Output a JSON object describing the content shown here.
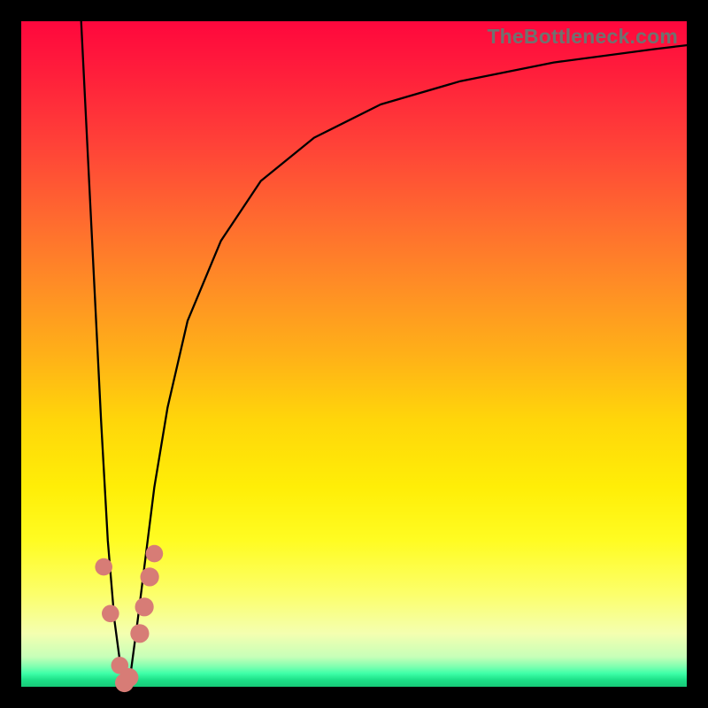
{
  "watermark": "TheBottleneck.com",
  "chart_data": {
    "type": "line",
    "title": "",
    "xlabel": "",
    "ylabel": "",
    "xlim": [
      0,
      100
    ],
    "ylim": [
      0,
      100
    ],
    "grid": false,
    "legend": false,
    "series": [
      {
        "name": "curve",
        "x": [
          9,
          10,
          11,
          12,
          13,
          14,
          15,
          15.7,
          16.5,
          17.5,
          18.5,
          20,
          22,
          25,
          30,
          36,
          44,
          54,
          66,
          80,
          95,
          100
        ],
        "y": [
          100,
          80,
          60,
          40,
          22,
          10,
          2.5,
          0,
          2.5,
          10,
          18,
          30,
          42,
          55,
          67,
          76,
          82.5,
          87.5,
          91,
          93.8,
          95.8,
          96.4
        ]
      }
    ],
    "markers": [
      {
        "x": 12.4,
        "y": 18.0,
        "r": 1.4
      },
      {
        "x": 13.4,
        "y": 11.0,
        "r": 1.4
      },
      {
        "x": 14.8,
        "y": 3.2,
        "r": 1.4
      },
      {
        "x": 15.5,
        "y": 0.6,
        "r": 1.6
      },
      {
        "x": 16.2,
        "y": 1.4,
        "r": 1.6
      },
      {
        "x": 17.8,
        "y": 8.0,
        "r": 1.6
      },
      {
        "x": 18.5,
        "y": 12.0,
        "r": 1.6
      },
      {
        "x": 19.3,
        "y": 16.5,
        "r": 1.6
      },
      {
        "x": 20.0,
        "y": 20.0,
        "r": 1.4
      }
    ],
    "background_gradient": {
      "top": "#ff073d",
      "mid": "#ffee07",
      "bottom": "#17c978"
    }
  }
}
